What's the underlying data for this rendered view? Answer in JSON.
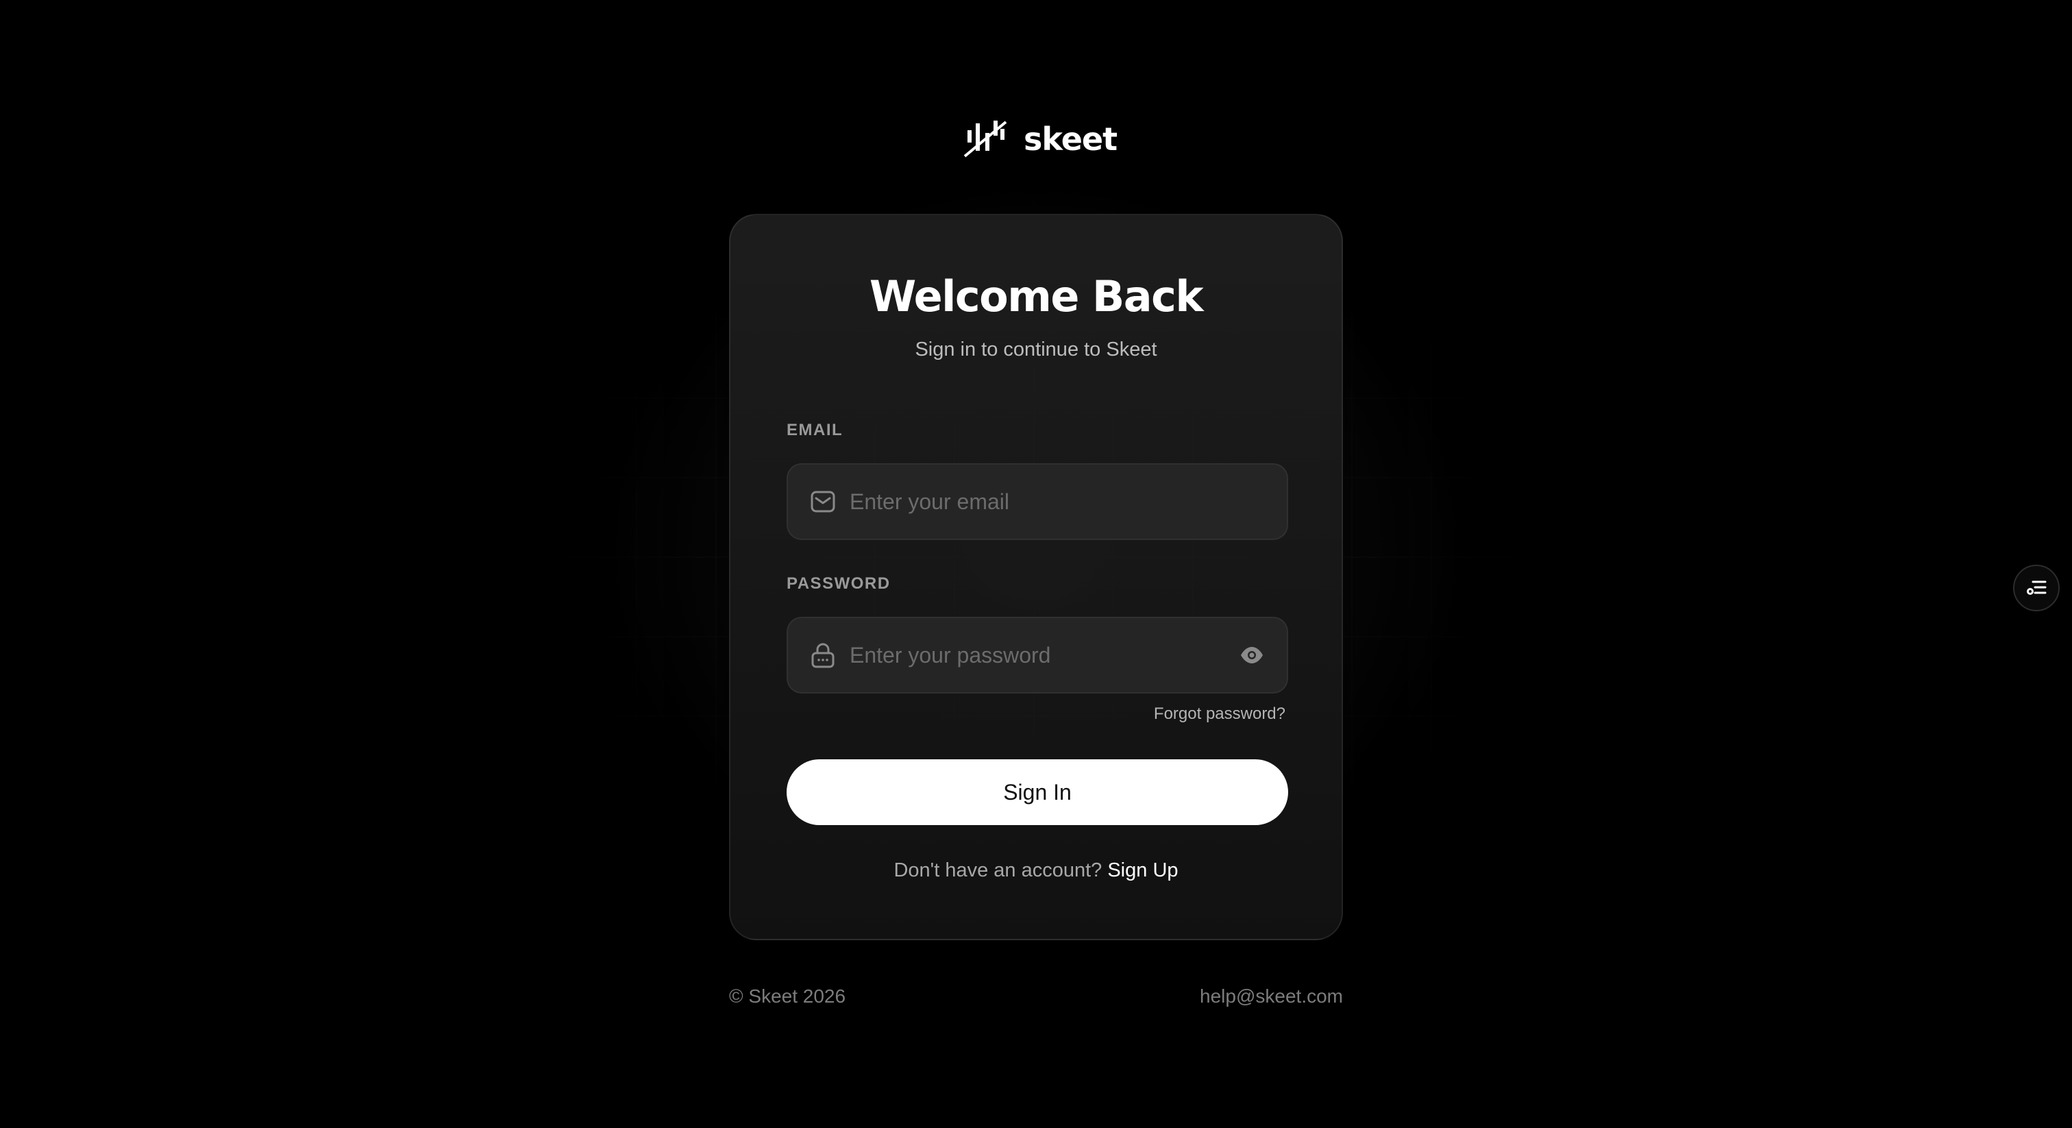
{
  "brand": {
    "name": "skeet",
    "logo_icon": "skeet-logo-icon"
  },
  "card": {
    "title": "Welcome Back",
    "subtitle": "Sign in to continue to Skeet"
  },
  "email": {
    "label": "EMAIL",
    "placeholder": "Enter your email",
    "value": "",
    "icon": "mail-icon"
  },
  "password": {
    "label": "PASSWORD",
    "placeholder": "Enter your password",
    "value": "",
    "icon": "lock-icon",
    "toggle_icon": "eye-icon"
  },
  "forgot_label": "Forgot password?",
  "signin_label": "Sign In",
  "signup": {
    "prompt": "Don't have an account?",
    "link": "Sign Up"
  },
  "footer": {
    "copyright": "© Skeet 2026",
    "email": "help@skeet.com"
  },
  "side_button": {
    "icon": "toolbar-list-icon"
  },
  "colors": {
    "background": "#000000",
    "card": "#1a1a1a",
    "field": "#252525",
    "button": "#ffffff"
  }
}
